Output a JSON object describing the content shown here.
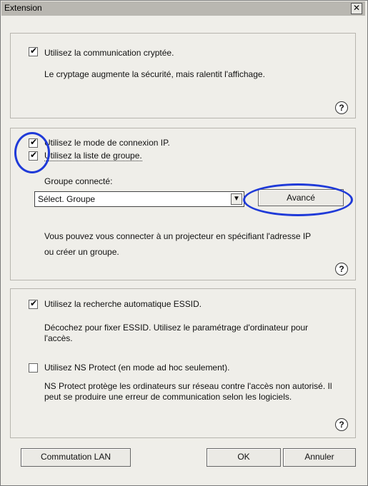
{
  "window": {
    "title": "Extension",
    "close_symbol": "✕"
  },
  "panel1": {
    "checkbox_label": "Utilisez la communication cryptée.",
    "checkbox_checked": true,
    "description": "Le cryptage augmente la sécurité, mais ralentit l'affichage.",
    "help": "?"
  },
  "panel2": {
    "ip_mode_label": "Utilisez le mode de connexion IP.",
    "ip_mode_checked": true,
    "group_list_label": "Utilisez la liste de groupe.",
    "group_list_checked": true,
    "group_label": "Groupe connecté:",
    "group_select": "Sélect. Groupe",
    "advanced_button": "Avancé",
    "description": "Vous pouvez vous connecter à un projecteur en spécifiant l'adresse IP ou créer un groupe.",
    "help": "?"
  },
  "panel3": {
    "essid_label": "Utilisez la recherche automatique ESSID.",
    "essid_checked": true,
    "essid_description": "Décochez pour fixer ESSID. Utilisez le paramétrage d'ordinateur pour l'accès.",
    "ns_protect_label": "Utilisez NS Protect (en mode ad hoc seulement).",
    "ns_protect_checked": false,
    "ns_description": "NS Protect protège les ordinateurs sur réseau contre l'accès non autorisé. Il peut se produire une erreur de communication selon les logiciels.",
    "help": "?"
  },
  "footer": {
    "lan_button": "Commutation LAN",
    "ok_button": "OK",
    "cancel_button": "Annuler"
  },
  "icons": {
    "check": "✔",
    "dropdown": "▼"
  },
  "colors": {
    "annotation_circle": "#1f3ad8"
  }
}
